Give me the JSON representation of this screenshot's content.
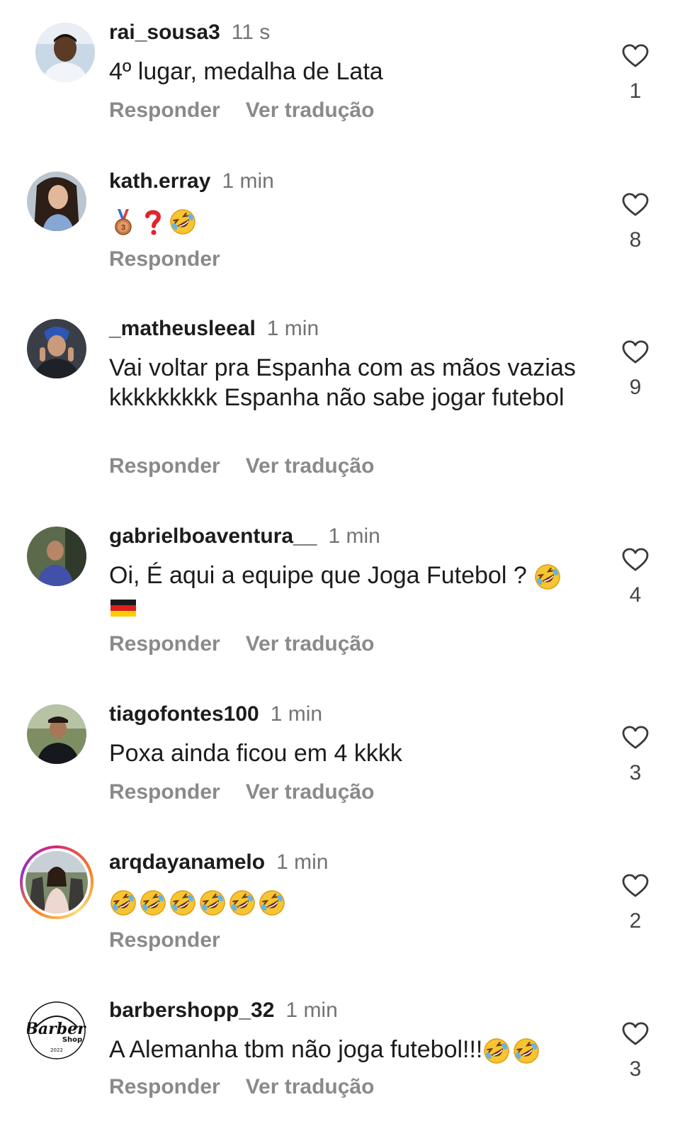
{
  "comments": [
    {
      "username": "rai_sousa3",
      "time": "11 s",
      "text": "4º lugar, medalha de Lata",
      "reply_label": "Responder",
      "translate_label": "Ver tradução",
      "likes": "1",
      "avatar": "person-avatar"
    },
    {
      "username": "kath.erray",
      "time": "1 min",
      "text": "",
      "emojis": [
        "bronze-medal-emoji",
        "red-question-mark-emoji",
        "rofl-emoji"
      ],
      "reply_label": "Responder",
      "likes": "8",
      "avatar": "person-avatar"
    },
    {
      "username": "_matheusleeal",
      "time": "1 min",
      "text": "Vai voltar pra Espanha com as mãos vazias kkkkkkkkk Espanha não sabe jogar futebol",
      "reply_label": "Responder",
      "translate_label": "Ver tradução",
      "likes": "9",
      "avatar": "person-avatar"
    },
    {
      "username": "gabrielboaventura__",
      "time": "1 min",
      "text": "Oi, É aqui a equipe que Joga Futebol ?",
      "emojis": [
        "rofl-emoji",
        "germany-flag-emoji"
      ],
      "reply_label": "Responder",
      "translate_label": "Ver tradução",
      "likes": "4",
      "avatar": "person-avatar"
    },
    {
      "username": "tiagofontes100",
      "time": "1 min",
      "text": "Poxa ainda ficou em 4 kkkk",
      "reply_label": "Responder",
      "translate_label": "Ver tradução",
      "likes": "3",
      "avatar": "person-avatar"
    },
    {
      "username": "arqdayanamelo",
      "time": "1 min",
      "text": "",
      "emojis": [
        "rofl-emoji",
        "rofl-emoji",
        "rofl-emoji",
        "rofl-emoji",
        "rofl-emoji",
        "rofl-emoji"
      ],
      "reply_label": "Responder",
      "likes": "2",
      "avatar": "person-avatar-story-ring"
    },
    {
      "username": "barbershopp_32",
      "time": "1 min",
      "text": "A Alemanha tbm não joga futebol!!!",
      "emojis": [
        "rofl-emoji",
        "rofl-emoji"
      ],
      "reply_label": "Responder",
      "translate_label": "Ver tradução",
      "likes": "3",
      "avatar": "barber-shop-logo",
      "logo_text": "Barber Shop 2022"
    }
  ],
  "colors": {
    "username": "#1c1c1c",
    "meta": "#737373",
    "action": "#8a8a8a",
    "heart_stroke": "#3a3a3a"
  }
}
